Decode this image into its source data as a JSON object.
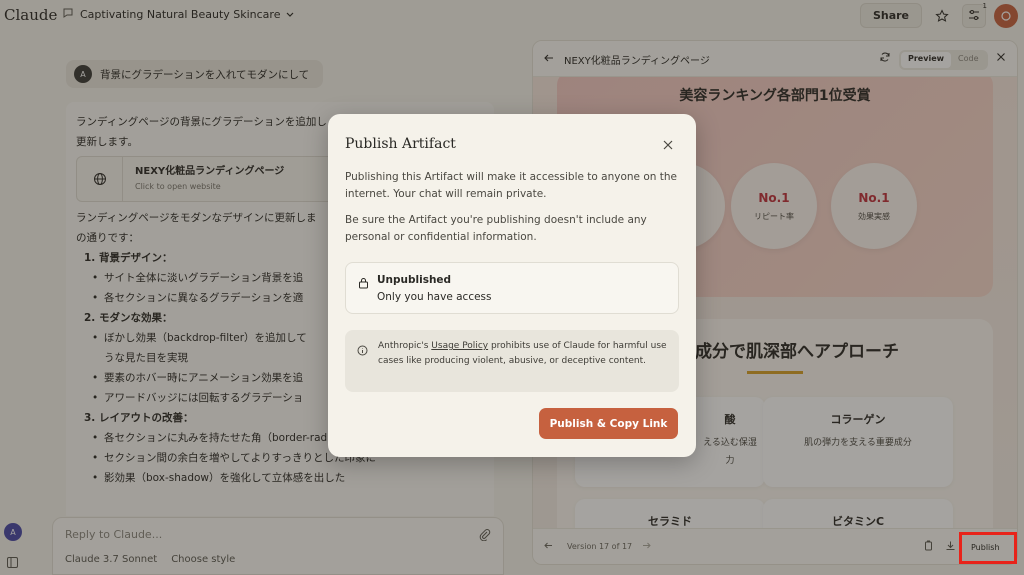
{
  "app": {
    "logo": "Claude"
  },
  "topbar": {
    "chat_title": "Captivating Natural Beauty Skincare",
    "share_label": "Share",
    "notifications_count": "1"
  },
  "chat": {
    "user_initial": "A",
    "user_message": "背景にグラデーションを入れてモダンにして",
    "assistant": {
      "intro_line1": "ランディングページの背景にグラデーションを追加し",
      "intro_line2": "更新します。",
      "artifact_title": "NEXY化粧品ランディングページ",
      "artifact_subtitle": "Click to open website",
      "summary_line1": "ランディングページをモダンなデザインに更新しま",
      "summary_line2": "の通りです：",
      "s1_title": "1. 背景デザイン：",
      "s1_b1": "サイト全体に淡いグラデーション背景を追",
      "s1_b2": "各セクションに異なるグラデーションを適",
      "s2_title": "2. モダンな効果：",
      "s2_b1": "ぼかし効果（backdrop-filter）を追加して",
      "s2_b1_cont": "うな見た目を実現",
      "s2_b2": "要素のホバー時にアニメーション効果を追",
      "s2_b3": "アワードバッジには回転するグラデーショ",
      "s3_title": "3. レイアウトの改善：",
      "s3_b1": "各セクションに丸みを持たせた角（border-radius）を追加",
      "s3_b2": "セクション間の余白を増やしてよりすっきりとした印象に",
      "s3_b3": "影効果（box-shadow）を強化して立体感を出した"
    }
  },
  "composer": {
    "placeholder": "Reply to Claude...",
    "model": "Claude 3.7 Sonnet",
    "style": "Choose style"
  },
  "sidebar": {
    "user_initial": "A"
  },
  "artifact_panel": {
    "title": "NEXY化粧品ランディングページ",
    "tab_preview": "Preview",
    "tab_code": "Code",
    "award_heading": "美容ランキング各部門1位受賞",
    "awards": [
      {
        "rank": "No.1",
        "label": "リピート率"
      },
      {
        "rank": "No.1",
        "label": "効果実感"
      }
    ],
    "ingredients_heading": "成分で肌深部へアプローチ",
    "ingredients": [
      {
        "name": "酸",
        "desc": "える込む保湿"
      },
      {
        "name": "コラーゲン",
        "desc": "肌の弾力を支える重要成分"
      },
      {
        "name": "セラミド",
        "desc": ""
      },
      {
        "name": "ビタミンC",
        "desc": ""
      }
    ],
    "ingredient_desc_wrap": "力",
    "version_label": "Version 17 of 17",
    "publish_label": "Publish"
  },
  "modal": {
    "title": "Publish Artifact",
    "para1": "Publishing this Artifact will make it accessible to anyone on the internet. Your chat will remain private.",
    "para2": "Be sure the Artifact you're publishing doesn't include any personal or confidential information.",
    "status_title": "Unpublished",
    "status_sub": "Only you have access",
    "policy_pre": "Anthropic's ",
    "policy_link": "Usage Policy",
    "policy_post": " prohibits use of Claude for harmful use cases like producing violent, abusive, or deceptive content.",
    "cta_label": "Publish & Copy Link"
  },
  "colors": {
    "accent": "#c6613f",
    "highlight": "#e8231a",
    "award_red": "#c0303b",
    "gold": "#d8a026"
  }
}
